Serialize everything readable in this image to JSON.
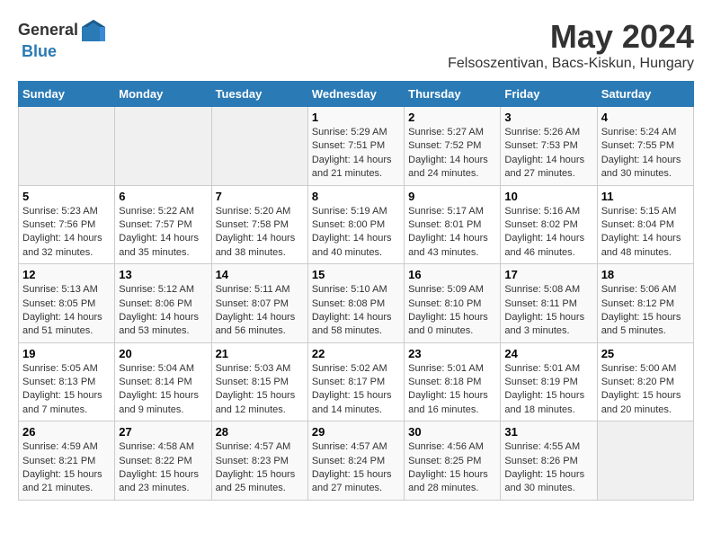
{
  "header": {
    "logo_general": "General",
    "logo_blue": "Blue",
    "month": "May 2024",
    "location": "Felsoszentivan, Bacs-Kiskun, Hungary"
  },
  "days_of_week": [
    "Sunday",
    "Monday",
    "Tuesday",
    "Wednesday",
    "Thursday",
    "Friday",
    "Saturday"
  ],
  "weeks": [
    [
      {
        "day": "",
        "info": ""
      },
      {
        "day": "",
        "info": ""
      },
      {
        "day": "",
        "info": ""
      },
      {
        "day": "1",
        "info": "Sunrise: 5:29 AM\nSunset: 7:51 PM\nDaylight: 14 hours\nand 21 minutes."
      },
      {
        "day": "2",
        "info": "Sunrise: 5:27 AM\nSunset: 7:52 PM\nDaylight: 14 hours\nand 24 minutes."
      },
      {
        "day": "3",
        "info": "Sunrise: 5:26 AM\nSunset: 7:53 PM\nDaylight: 14 hours\nand 27 minutes."
      },
      {
        "day": "4",
        "info": "Sunrise: 5:24 AM\nSunset: 7:55 PM\nDaylight: 14 hours\nand 30 minutes."
      }
    ],
    [
      {
        "day": "5",
        "info": "Sunrise: 5:23 AM\nSunset: 7:56 PM\nDaylight: 14 hours\nand 32 minutes."
      },
      {
        "day": "6",
        "info": "Sunrise: 5:22 AM\nSunset: 7:57 PM\nDaylight: 14 hours\nand 35 minutes."
      },
      {
        "day": "7",
        "info": "Sunrise: 5:20 AM\nSunset: 7:58 PM\nDaylight: 14 hours\nand 38 minutes."
      },
      {
        "day": "8",
        "info": "Sunrise: 5:19 AM\nSunset: 8:00 PM\nDaylight: 14 hours\nand 40 minutes."
      },
      {
        "day": "9",
        "info": "Sunrise: 5:17 AM\nSunset: 8:01 PM\nDaylight: 14 hours\nand 43 minutes."
      },
      {
        "day": "10",
        "info": "Sunrise: 5:16 AM\nSunset: 8:02 PM\nDaylight: 14 hours\nand 46 minutes."
      },
      {
        "day": "11",
        "info": "Sunrise: 5:15 AM\nSunset: 8:04 PM\nDaylight: 14 hours\nand 48 minutes."
      }
    ],
    [
      {
        "day": "12",
        "info": "Sunrise: 5:13 AM\nSunset: 8:05 PM\nDaylight: 14 hours\nand 51 minutes."
      },
      {
        "day": "13",
        "info": "Sunrise: 5:12 AM\nSunset: 8:06 PM\nDaylight: 14 hours\nand 53 minutes."
      },
      {
        "day": "14",
        "info": "Sunrise: 5:11 AM\nSunset: 8:07 PM\nDaylight: 14 hours\nand 56 minutes."
      },
      {
        "day": "15",
        "info": "Sunrise: 5:10 AM\nSunset: 8:08 PM\nDaylight: 14 hours\nand 58 minutes."
      },
      {
        "day": "16",
        "info": "Sunrise: 5:09 AM\nSunset: 8:10 PM\nDaylight: 15 hours\nand 0 minutes."
      },
      {
        "day": "17",
        "info": "Sunrise: 5:08 AM\nSunset: 8:11 PM\nDaylight: 15 hours\nand 3 minutes."
      },
      {
        "day": "18",
        "info": "Sunrise: 5:06 AM\nSunset: 8:12 PM\nDaylight: 15 hours\nand 5 minutes."
      }
    ],
    [
      {
        "day": "19",
        "info": "Sunrise: 5:05 AM\nSunset: 8:13 PM\nDaylight: 15 hours\nand 7 minutes."
      },
      {
        "day": "20",
        "info": "Sunrise: 5:04 AM\nSunset: 8:14 PM\nDaylight: 15 hours\nand 9 minutes."
      },
      {
        "day": "21",
        "info": "Sunrise: 5:03 AM\nSunset: 8:15 PM\nDaylight: 15 hours\nand 12 minutes."
      },
      {
        "day": "22",
        "info": "Sunrise: 5:02 AM\nSunset: 8:17 PM\nDaylight: 15 hours\nand 14 minutes."
      },
      {
        "day": "23",
        "info": "Sunrise: 5:01 AM\nSunset: 8:18 PM\nDaylight: 15 hours\nand 16 minutes."
      },
      {
        "day": "24",
        "info": "Sunrise: 5:01 AM\nSunset: 8:19 PM\nDaylight: 15 hours\nand 18 minutes."
      },
      {
        "day": "25",
        "info": "Sunrise: 5:00 AM\nSunset: 8:20 PM\nDaylight: 15 hours\nand 20 minutes."
      }
    ],
    [
      {
        "day": "26",
        "info": "Sunrise: 4:59 AM\nSunset: 8:21 PM\nDaylight: 15 hours\nand 21 minutes."
      },
      {
        "day": "27",
        "info": "Sunrise: 4:58 AM\nSunset: 8:22 PM\nDaylight: 15 hours\nand 23 minutes."
      },
      {
        "day": "28",
        "info": "Sunrise: 4:57 AM\nSunset: 8:23 PM\nDaylight: 15 hours\nand 25 minutes."
      },
      {
        "day": "29",
        "info": "Sunrise: 4:57 AM\nSunset: 8:24 PM\nDaylight: 15 hours\nand 27 minutes."
      },
      {
        "day": "30",
        "info": "Sunrise: 4:56 AM\nSunset: 8:25 PM\nDaylight: 15 hours\nand 28 minutes."
      },
      {
        "day": "31",
        "info": "Sunrise: 4:55 AM\nSunset: 8:26 PM\nDaylight: 15 hours\nand 30 minutes."
      },
      {
        "day": "",
        "info": ""
      }
    ]
  ]
}
